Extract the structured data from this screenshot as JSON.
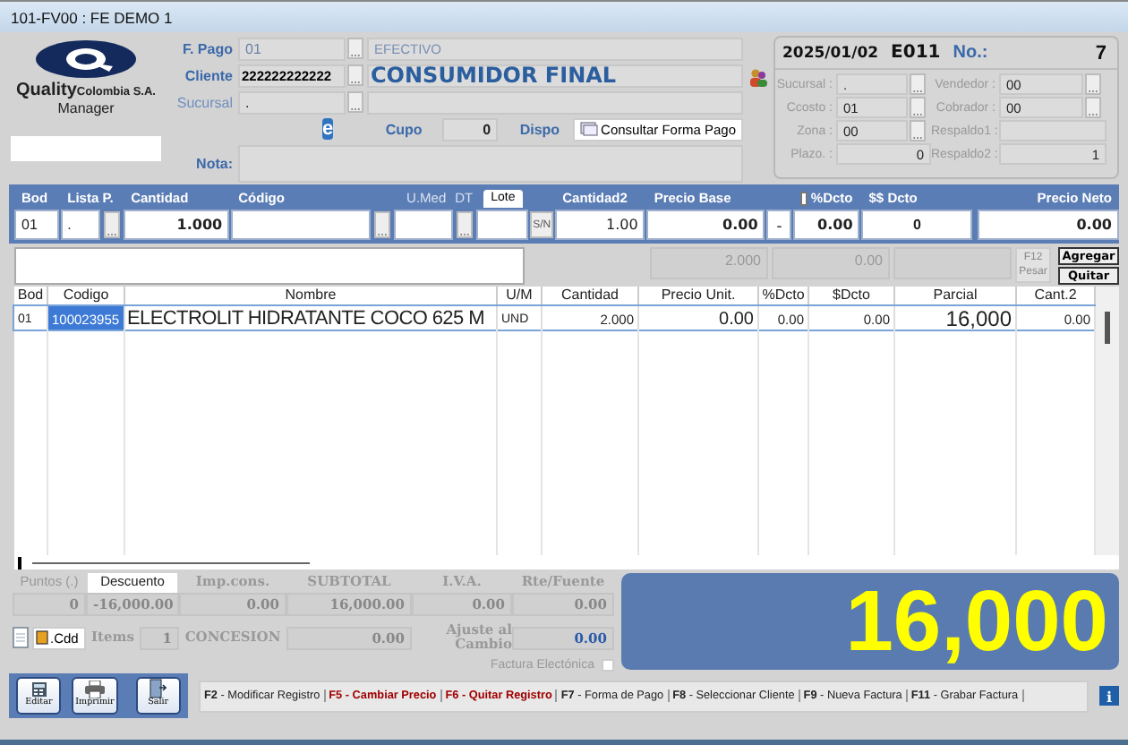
{
  "window": {
    "title": "101-FV00 : FE DEMO 1"
  },
  "logo": {
    "brand": "Quality",
    "company": "Colombia S.A.",
    "product": "Manager"
  },
  "header": {
    "fields": [
      {
        "label": "F. Pago",
        "code": "01",
        "name": "EFECTIVO",
        "kind": "muted"
      },
      {
        "label": "Cliente",
        "code": "222222222222",
        "name": "CONSUMIDOR FINAL",
        "kind": "strong"
      },
      {
        "label": "Sucursal",
        "code": ".",
        "kind": "faint"
      }
    ],
    "email_glyph": "e",
    "cupo": {
      "label": "Cupo",
      "value": "0"
    },
    "dispo": {
      "label": "Dispo",
      "button": "Consultar Forma Pago"
    },
    "nota": {
      "label": "Nota:"
    }
  },
  "doc": {
    "date": "2025/01/02",
    "prefix": "E011",
    "number_label": "No.:",
    "number": "7",
    "fields": [
      {
        "label": "Sucursal :",
        "value": ".",
        "kind": "lookup"
      },
      {
        "label": "Vendedor :",
        "value": "00",
        "kind": "lookup"
      },
      {
        "label": "Ccosto :",
        "value": "01",
        "kind": "lookup"
      },
      {
        "label": "Cobrador :",
        "value": "00",
        "kind": "lookup"
      },
      {
        "label": "Zona :",
        "value": "00",
        "kind": "lookup"
      },
      {
        "label": "Respaldo1 :",
        "kind": "text"
      },
      {
        "label": "Plazo. :",
        "value": "0",
        "kind": "number"
      },
      {
        "label": "Respaldo2 :",
        "value": "1",
        "kind": "number"
      }
    ]
  },
  "entry": {
    "bod": {
      "label": "Bod",
      "value": "01"
    },
    "lista": {
      "label": "Lista P.",
      "value": "."
    },
    "cantidad": {
      "label": "Cantidad",
      "value": "1.000"
    },
    "codigo": {
      "label": "Código"
    },
    "umed": {
      "label": "U.Med"
    },
    "dt": {
      "label": "DT"
    },
    "lote": "Lote",
    "sn": "S/N",
    "cantidad2": {
      "label": "Cantidad2",
      "value": "1.00"
    },
    "precio_base": {
      "label": "Precio Base",
      "value": "0.00"
    },
    "sign": "-",
    "dcto_pct": {
      "label": "%Dcto",
      "checked": false,
      "value": "0.00"
    },
    "dcto_val": {
      "label": "$$ Dcto",
      "value": "0"
    },
    "precio_neto": {
      "label": "Precio Neto",
      "value": "0.00"
    }
  },
  "stats": {
    "values": [
      "2.000",
      "0.00"
    ],
    "weigh": {
      "key": "F12",
      "label": "Pesar"
    },
    "add": "Agregar",
    "remove": "Quitar"
  },
  "table": {
    "columns": [
      {
        "label": "Bod"
      },
      {
        "label": "Codigo"
      },
      {
        "label": "Nombre"
      },
      {
        "label": "U/M"
      },
      {
        "label": "Cantidad"
      },
      {
        "label": "Precio Unit."
      },
      {
        "label": "%Dcto"
      },
      {
        "label": "$Dcto"
      },
      {
        "label": "Parcial"
      },
      {
        "label": "Cant.2"
      }
    ],
    "rows": [
      {
        "selected": true,
        "cells": [
          "01",
          "100023955",
          "ELECTROLIT HIDRATANTE COCO 625 M",
          "UND",
          "2.000",
          "0.00",
          "0.00",
          "0.00",
          "16,000",
          "0.00"
        ]
      }
    ]
  },
  "totals": {
    "labels": [
      {
        "text": "Puntos (.)",
        "kind": "faint"
      },
      {
        "text": "Descuento",
        "kind": "tab"
      },
      {
        "text": "Imp.cons.",
        "kind": "label"
      },
      {
        "text": "SUBTOTAL",
        "kind": "label"
      },
      {
        "text": "I.V.A.",
        "kind": "label"
      },
      {
        "text": "Rte/Fuente",
        "kind": "label"
      }
    ],
    "values": [
      "0",
      "-16,000.00",
      "0.00",
      "16,000.00",
      "0.00",
      "0.00"
    ],
    "cdd": ".Cdd",
    "items_label": "Items",
    "items": "1",
    "concesion_label": "CONCESION",
    "concesion": "0.00",
    "ajuste_label": "Ajuste al Cambio",
    "ajuste": "0.00",
    "factura": {
      "label": "Factura Electónica",
      "checked": false
    }
  },
  "grand_total": "16,000",
  "actions": [
    {
      "label": "Editar",
      "kind": "edit"
    },
    {
      "label": "Imprimir",
      "kind": "print"
    },
    {
      "label": "Salir",
      "kind": "exit"
    }
  ],
  "shortcuts": [
    {
      "key": "F2",
      "label": "- Modificar Registro",
      "emphasized": false
    },
    {
      "key": "F5",
      "label": "- Cambiar Precio",
      "emphasized": true
    },
    {
      "key": "F6",
      "label": "- Quitar  Registro",
      "emphasized": true
    },
    {
      "key": "F7",
      "label": "- Forma de Pago",
      "emphasized": false
    },
    {
      "key": "F8",
      "label": "- Seleccionar Cliente",
      "emphasized": false
    },
    {
      "key": "F9",
      "label": "- Nueva Factura",
      "emphasized": false
    },
    {
      "key": "F11",
      "label": "- Grabar Factura",
      "emphasized": false
    }
  ],
  "info_glyph": "i"
}
